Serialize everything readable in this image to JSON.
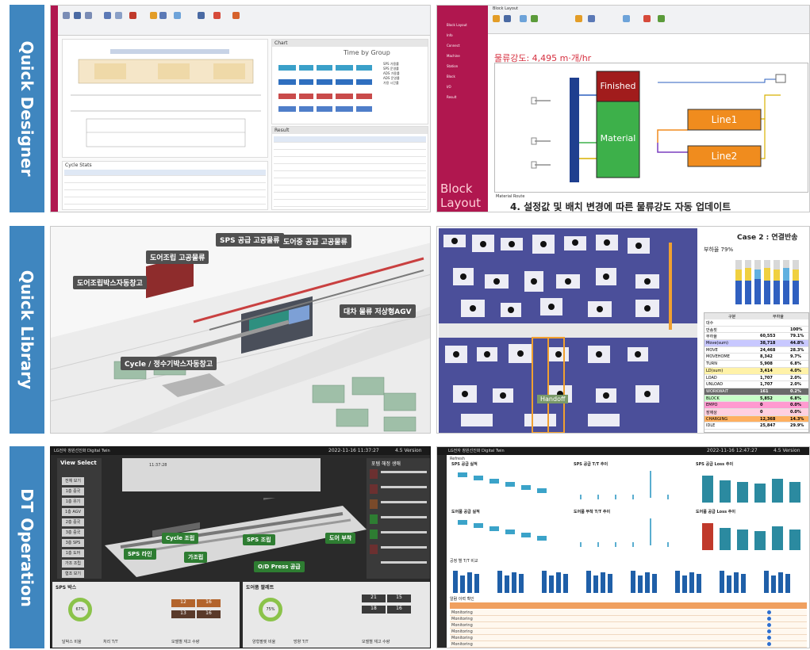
{
  "rows": [
    {
      "label": "Quick Designer"
    },
    {
      "label": "Quick Library"
    },
    {
      "label": "DT Operation"
    }
  ],
  "qd_left": {
    "chart_title": "Chart",
    "chart_heading": "Time by Group",
    "result_title": "Result",
    "cycle_title": "Cycle Stats",
    "legend": [
      "SPS 가용률",
      "SPS 운영률",
      "ADS 가용률",
      "ADS 운영률",
      "가용 시간률"
    ]
  },
  "qd_right": {
    "block_layout_title": "Block Layout",
    "flow_label": "물류강도: 4,495 m·개/hr",
    "finished": "Finished",
    "material": "Material",
    "line1": "Line1",
    "line2": "Line2",
    "side_big": "Block Layout",
    "route_label": "Material Route",
    "caption": "4. 설정값 및 배치 변경에 따른 물류강도 자동 업데이트",
    "nav": [
      "Block Layout",
      "Info",
      "Connect",
      "Machine",
      "Station",
      "Block",
      "I/O",
      "Result"
    ]
  },
  "ql_left": {
    "labels": [
      "SPS 공급 고공물류",
      "도어중 공급 고공물류",
      "도어조립 고공물류",
      "도어조립박스자동창고",
      "대차 물류 저상형AGV",
      "Cycle / 정수기박스자동창고"
    ]
  },
  "ql_right": {
    "case_title": "Case 2 : 연결반송",
    "rate_label": "부하율 79%",
    "handoff": "Handoff",
    "table_headers": [
      "구분",
      "부하율"
    ],
    "table_rows": [
      [
        "대수",
        "",
        ""
      ],
      [
        "반송횟",
        "",
        "100%"
      ],
      [
        "부하율",
        "60,553",
        "79.1%"
      ],
      [
        "Move(sum)",
        "38,718",
        "44.8%"
      ],
      [
        "MOVE",
        "24,468",
        "28.3%"
      ],
      [
        "MOVEHOME",
        "8,342",
        "9.7%"
      ],
      [
        "TURN",
        "5,908",
        "6.8%"
      ],
      [
        "LD(sum)",
        "3,414",
        "4.0%"
      ],
      [
        "LOAD",
        "1,707",
        "2.0%"
      ],
      [
        "UNLOAD",
        "1,707",
        "2.0%"
      ],
      [
        "WORKWAIT",
        "161",
        "0.2%"
      ],
      [
        "BLOCK",
        "5,852",
        "6.8%"
      ],
      [
        "EMPO",
        "0",
        "0.0%"
      ],
      [
        "장애상",
        "0",
        "0.0%"
      ],
      [
        "CHARGING",
        "12,368",
        "14.3%"
      ],
      [
        "IDLE",
        "25,847",
        "29.9%"
      ]
    ]
  },
  "dt_left": {
    "title": "LG전자 창원선진화 Digital Twin",
    "timestamp": "2022-11-16 11:37:27",
    "version": "4.5 Version",
    "view_select": "View Select",
    "view_buttons": [
      "전체 보기",
      "1층 중국",
      "1층 유기",
      "1층 AGV",
      "2층 중국",
      "3층 중국",
      "3층 SPS",
      "1층 도어",
      "가조 조립",
      "협조 보기"
    ],
    "right_title": "포템 해정 생애",
    "status_time": "11:37:28",
    "yard_labels": [
      "Cycle 조립",
      "SPS 조립",
      "도어 부착",
      "SPS 라인",
      "가조립",
      "O/D Press 공급"
    ],
    "sps_box": "SPS 박스",
    "door_pallet": "도어품 팔레트",
    "gauge1": "67%",
    "gauge2": "75%",
    "stats": [
      "12",
      "16",
      "13",
      "16",
      "21",
      "15",
      "18",
      "16"
    ],
    "footer": [
      "달박스 비율",
      "처리 T/T",
      "모델별 재고 수량",
      "양형팔렛 비율",
      "방향 T/T",
      "모델별 재고 수량"
    ]
  },
  "dt_right": {
    "title": "LG전자 창원선진화 Digital Twin",
    "timestamp": "2022-11-16 12:47:27",
    "version": "4.5 Version",
    "refresh": "Refresh",
    "chart_titles": [
      "SPS 공급 실적",
      "SPS 공급 T/T 추이",
      "SPS 공급 Loss 추이",
      "도어품 공급 실적",
      "도어품 부착 T/T 추이",
      "도어품 공급 Loss 추이"
    ],
    "tt_title": "공정 별 T/T 비교",
    "history_title": "알람 이력 확인",
    "history_rows": [
      "Monitoring",
      "Monitoring",
      "Monitoring",
      "Monitoring",
      "Monitoring",
      "Monitoring"
    ]
  },
  "colors": {
    "accent": "#3f86bf",
    "brand_red": "#b0174f",
    "orange": "#f08c1e",
    "green": "#3db04a",
    "dark_red": "#a11c1c"
  }
}
